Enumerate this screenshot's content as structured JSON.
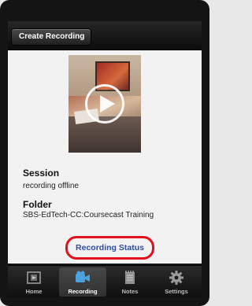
{
  "navbar": {
    "back_label": "Create Recording"
  },
  "video": {
    "state": "paused"
  },
  "session": {
    "heading": "Session",
    "value": "recording offline"
  },
  "folder": {
    "heading": "Folder",
    "value": "SBS-EdTech-CC:Coursecast Training"
  },
  "status_link": {
    "label": "Recording Status"
  },
  "tabs": [
    {
      "label": "Home",
      "icon": "home-icon",
      "selected": false
    },
    {
      "label": "Recording",
      "icon": "video-camera-icon",
      "selected": true
    },
    {
      "label": "Notes",
      "icon": "notepad-icon",
      "selected": false
    },
    {
      "label": "Settings",
      "icon": "gear-icon",
      "selected": false
    }
  ],
  "colors": {
    "link_text": "#2d4da0",
    "highlight_ring": "#e2111a",
    "selected_tab_icon": "#4aa3df"
  }
}
